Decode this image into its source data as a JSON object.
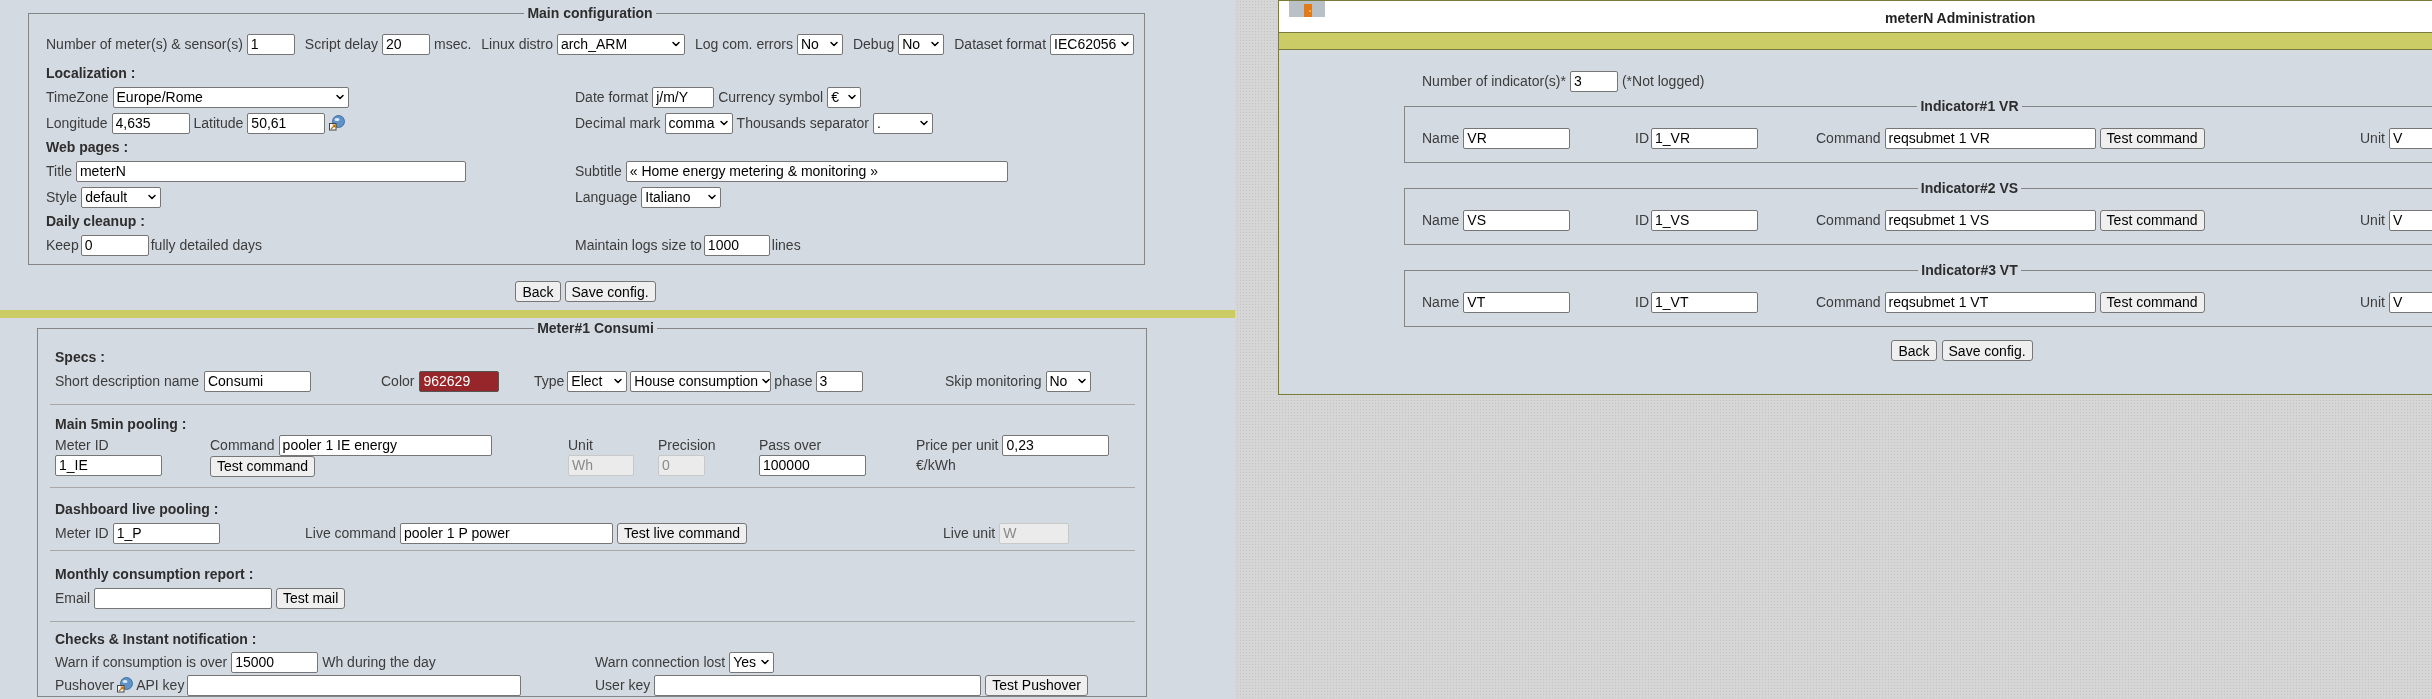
{
  "main_config": {
    "title": "Main configuration",
    "meters": {
      "label": "Number of meter(s) & sensor(s)",
      "value": "1"
    },
    "script_delay": {
      "label": "Script delay",
      "value": "20",
      "unit": "msec."
    },
    "linux_distro": {
      "label": "Linux distro",
      "value": "arch_ARM"
    },
    "log_com_errors": {
      "label": "Log com. errors",
      "value": "No"
    },
    "debug": {
      "label": "Debug",
      "value": "No"
    },
    "dataset_format": {
      "label": "Dataset format",
      "value": "IEC62056"
    },
    "localization": {
      "heading": "Localization :",
      "timezone": {
        "label": "TimeZone",
        "value": "Europe/Rome"
      },
      "longitude": {
        "label": "Longitude",
        "value": "4,635"
      },
      "latitude": {
        "label": "Latitude",
        "value": "50,61"
      },
      "date_format": {
        "label": "Date format",
        "value": "j/m/Y"
      },
      "currency_symbol": {
        "label": "Currency symbol",
        "value": "€"
      },
      "decimal_mark": {
        "label": "Decimal mark",
        "value": "comma"
      },
      "thousands_separator": {
        "label": "Thousands separator",
        "value": "."
      }
    },
    "web_pages": {
      "heading": "Web pages :",
      "title": {
        "label": "Title",
        "value": "meterN"
      },
      "subtitle": {
        "label": "Subtitle",
        "value": "« Home energy metering & monitoring »"
      },
      "style": {
        "label": "Style",
        "value": "default"
      },
      "language": {
        "label": "Language",
        "value": "Italiano"
      }
    },
    "daily_cleanup": {
      "heading": "Daily cleanup :",
      "keep": {
        "label": "Keep",
        "value": "0",
        "unit": "fully detailed days"
      },
      "maintain_logs": {
        "label": "Maintain logs size to",
        "value": "1000",
        "unit": "lines"
      }
    }
  },
  "main_buttons": [
    "Back",
    "Save config."
  ],
  "meter": {
    "title": "Meter#1 Consumi",
    "specs": {
      "heading": "Specs :",
      "name": {
        "label": "Short description name",
        "value": "Consumi"
      },
      "color": {
        "label": "Color",
        "value": "962629",
        "color": "#962629"
      },
      "type": {
        "label": "Type",
        "value": "Elect"
      },
      "usage": {
        "value": "House consumption"
      },
      "phase": {
        "label": "phase",
        "value": "3"
      },
      "skip_monitoring": {
        "label": "Skip monitoring",
        "value": "No"
      }
    },
    "main_pooling": {
      "heading": "Main 5min pooling :",
      "meter_id": {
        "label": "Meter ID",
        "value": "1_IE"
      },
      "command": {
        "label": "Command",
        "value": "pooler 1 IE energy",
        "button": "Test command"
      },
      "unit": {
        "label": "Unit",
        "value": "Wh",
        "disabled": true
      },
      "precision": {
        "label": "Precision",
        "value": "0",
        "disabled": true
      },
      "pass_over": {
        "label": "Pass over",
        "value": "100000",
        "disabled": false
      },
      "price": {
        "label": "Price per unit",
        "value": "0,23",
        "unit": "€/kWh"
      }
    },
    "live_pooling": {
      "heading": "Dashboard live pooling :",
      "meter_id": {
        "label": "Meter ID",
        "value": "1_P"
      },
      "live_command": {
        "label": "Live command",
        "value": "pooler 1 P power",
        "button": "Test live command"
      },
      "live_unit": {
        "label": "Live unit",
        "value": "W",
        "disabled": true
      }
    },
    "report": {
      "heading": "Monthly consumption report :",
      "email": {
        "label": "Email",
        "button": "Test mail"
      }
    },
    "checks": {
      "heading": "Checks & Instant notification :",
      "warn_over": {
        "label": "Warn if consumption is over",
        "value": "15000",
        "unit": "Wh during the day"
      },
      "warn_lost": {
        "label": "Warn connection lost",
        "value": "Yes"
      },
      "pushover": {
        "label": "Pushover",
        "api_label": "API key",
        "user_label": "User key",
        "button": "Test Pushover"
      }
    }
  },
  "admin": {
    "title": "meterN Administration",
    "indicator_count": {
      "label": "Number of indicator(s)*",
      "value": "3",
      "note": "(*Not logged)"
    },
    "indicators": [
      {
        "title": "Indicator#1 VR",
        "name_label": "Name",
        "name": "VR",
        "id_label": "ID",
        "id": "1_VR",
        "command_label": "Command",
        "command": "reqsubmet 1 VR",
        "button": "Test command",
        "unit_label": "Unit",
        "unit": "V"
      },
      {
        "title": "Indicator#2 VS",
        "name_label": "Name",
        "name": "VS",
        "id_label": "ID",
        "id": "1_VS",
        "command_label": "Command",
        "command": "reqsubmet 1 VS",
        "button": "Test command",
        "unit_label": "Unit",
        "unit": "V"
      },
      {
        "title": "Indicator#3 VT",
        "name_label": "Name",
        "name": "VT",
        "id_label": "ID",
        "id": "1_VT",
        "command_label": "Command",
        "command": "reqsubmet 1 VT",
        "button": "Test command",
        "unit_label": "Unit",
        "unit": "V"
      }
    ],
    "buttons": [
      "Back",
      "Save config."
    ]
  }
}
